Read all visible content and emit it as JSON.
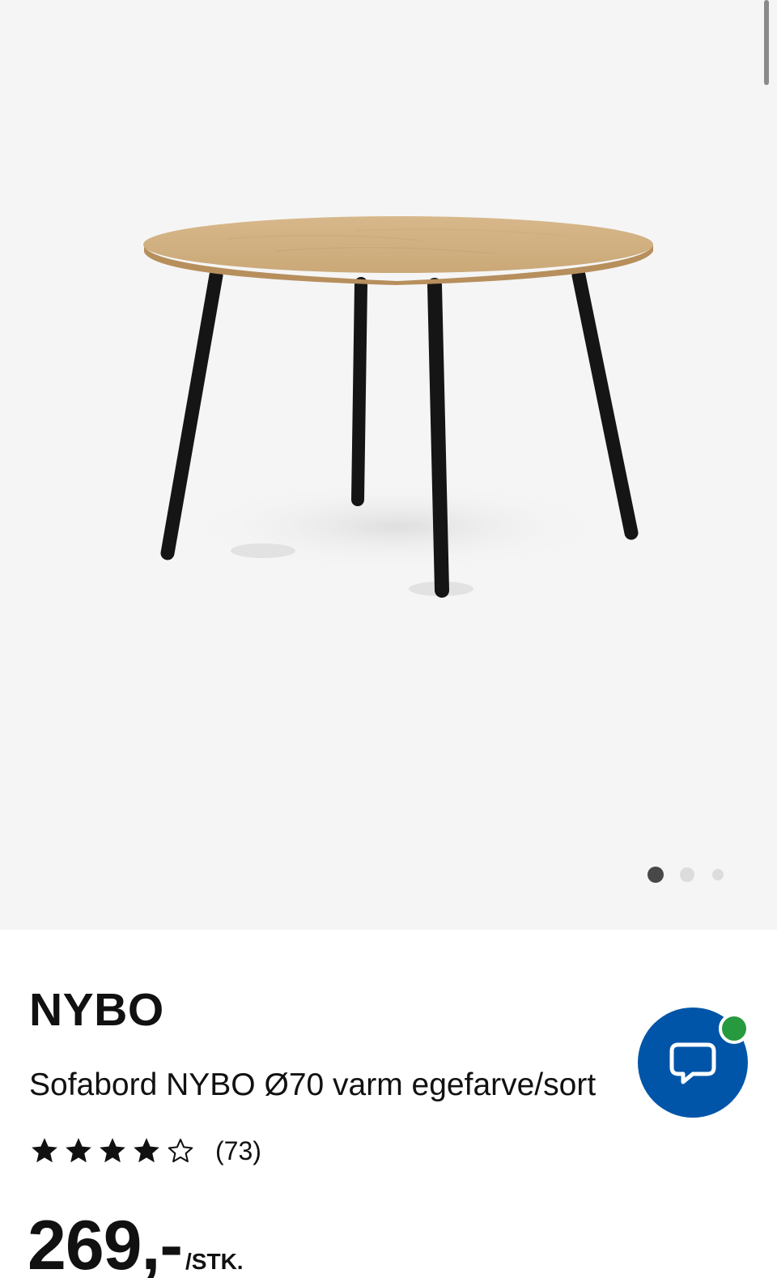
{
  "product": {
    "brand": "NYBO",
    "description": "Sofabord NYBO Ø70 varm egefarve/sort",
    "rating": {
      "stars": 4.5,
      "max_stars": 5,
      "review_count": "(73)"
    },
    "price": {
      "amount": "269,-",
      "unit": "/STK."
    }
  },
  "gallery": {
    "image_count": 3,
    "active_index": 0
  },
  "icons": {
    "chat": "chat-bubble-icon",
    "star": "star-icon"
  },
  "colors": {
    "chat_button": "#0055a8",
    "online_status": "#279a3f",
    "gallery_background": "#f5f5f5"
  }
}
